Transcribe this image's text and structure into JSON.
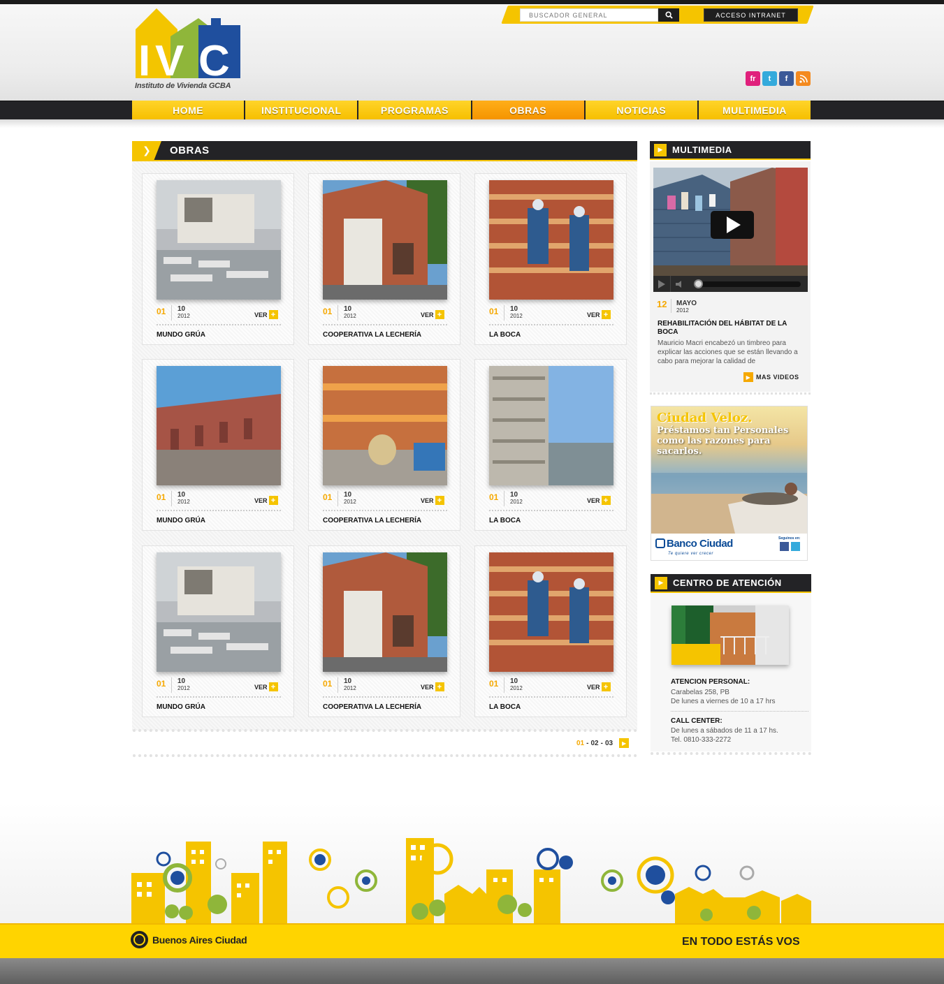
{
  "header": {
    "logo_text": "IVC",
    "logo_tagline": "Instituto de Vivienda GCBA",
    "search_placeholder": "BUSCADOR GENERAL",
    "intranet_label": "ACCESO INTRANET",
    "social": [
      {
        "name": "fr",
        "icon": "friendfeed-icon",
        "color": "#e0207c"
      },
      {
        "name": "twitter",
        "icon": "twitter-icon",
        "color": "#34aadc"
      },
      {
        "name": "facebook",
        "icon": "facebook-icon",
        "color": "#3b5998"
      },
      {
        "name": "rss",
        "icon": "rss-icon",
        "color": "#f48a1f"
      }
    ]
  },
  "nav": {
    "items": [
      "HOME",
      "INSTITUCIONAL",
      "PROGRAMAS",
      "OBRAS",
      "NOTICIAS",
      "MULTIMEDIA"
    ],
    "active": "OBRAS"
  },
  "obras": {
    "title": "OBRAS",
    "cards": [
      {
        "day": "01",
        "month": "10",
        "year": "2012",
        "ver": "VER",
        "title": "MUNDO GRÚA"
      },
      {
        "day": "01",
        "month": "10",
        "year": "2012",
        "ver": "VER",
        "title": "COOPERATIVA LA LECHERÍA"
      },
      {
        "day": "01",
        "month": "10",
        "year": "2012",
        "ver": "VER",
        "title": "LA BOCA"
      },
      {
        "day": "01",
        "month": "10",
        "year": "2012",
        "ver": "VER",
        "title": "MUNDO GRÚA"
      },
      {
        "day": "01",
        "month": "10",
        "year": "2012",
        "ver": "VER",
        "title": "COOPERATIVA LA LECHERÍA"
      },
      {
        "day": "01",
        "month": "10",
        "year": "2012",
        "ver": "VER",
        "title": "LA BOCA"
      },
      {
        "day": "01",
        "month": "10",
        "year": "2012",
        "ver": "VER",
        "title": "MUNDO GRÚA"
      },
      {
        "day": "01",
        "month": "10",
        "year": "2012",
        "ver": "VER",
        "title": "COOPERATIVA LA LECHERÍA"
      },
      {
        "day": "01",
        "month": "10",
        "year": "2012",
        "ver": "VER",
        "title": "LA BOCA"
      }
    ],
    "pager": {
      "current": "01",
      "sep": "-",
      "p2": "02",
      "p3": "03"
    }
  },
  "multimedia": {
    "title": "MULTIMEDIA",
    "day": "12",
    "month": "MAYO",
    "year": "2012",
    "headline": "REHABILITACIÓN DEL HÁBITAT DE LA BOCA",
    "text": "Mauricio Macri encabezó un timbreo para explicar las acciones que se están llevando a cabo para mejorar la calidad de",
    "more": "MAS VIDEOS"
  },
  "banner": {
    "headline": "Ciudad Veloz.",
    "subline": "Préstamos tan Personales como las razones para sacarlos.",
    "bank": "Banco Ciudad",
    "bank_tag": "Te quiere ver crecer",
    "follow": "Seguinos en:"
  },
  "atencion": {
    "title": "CENTRO DE ATENCIÓN",
    "personal_label": "ATENCION PERSONAL:",
    "personal_lines": [
      "Carabelas 258, PB",
      "De lunes a viernes de 10 a 17 hrs"
    ],
    "call_label": "CALL CENTER:",
    "call_lines": [
      "De lunes a sábados de 11 a 17 hs.",
      "Tel. 0810-333-2272"
    ]
  },
  "footer": {
    "ba_name": "Buenos Aires Ciudad",
    "slogan": "EN TODO ESTÁS VOS"
  },
  "colors": {
    "accent": "#f5c400",
    "orange": "#f5a800",
    "dark": "#232326"
  }
}
